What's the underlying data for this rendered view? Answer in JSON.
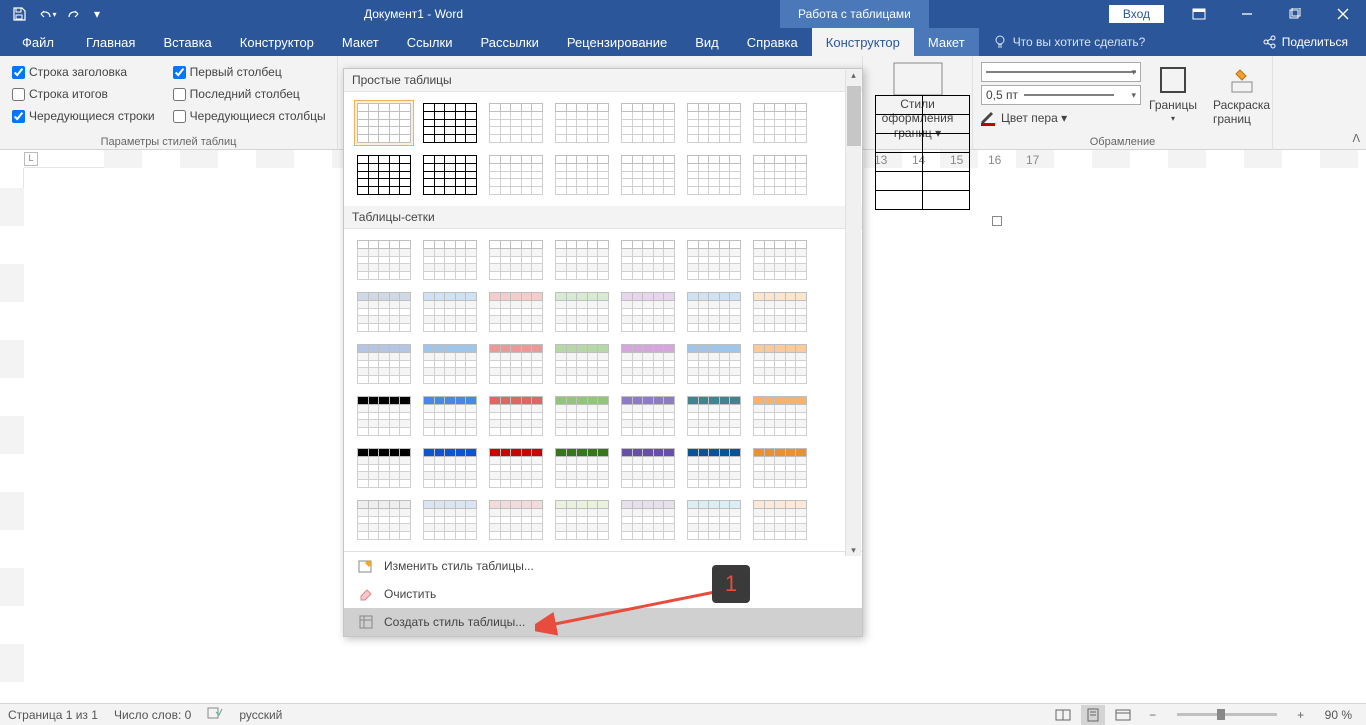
{
  "titlebar": {
    "doc_title": "Документ1 - Word",
    "context_tab": "Работа с таблицами",
    "login": "Вход"
  },
  "tabs": {
    "file": "Файл",
    "home": "Главная",
    "insert": "Вставка",
    "design": "Конструктор",
    "layout": "Макет",
    "refs": "Ссылки",
    "mailings": "Рассылки",
    "review": "Рецензирование",
    "view": "Вид",
    "help": "Справка",
    "ctx_design": "Конструктор",
    "ctx_layout": "Макет",
    "tell_me": "Что вы хотите сделать?",
    "share": "Поделиться"
  },
  "ribbon": {
    "style_options": {
      "header_row": "Строка заголовка",
      "total_row": "Строка итогов",
      "banded_rows": "Чередующиеся строки",
      "first_col": "Первый столбец",
      "last_col": "Последний столбец",
      "banded_cols": "Чередующиеся столбцы",
      "group_label": "Параметры стилей таблиц"
    },
    "shading_group": "Стили оформления границ ▾",
    "borders": {
      "line_weight": "0,5 пт",
      "pen_color": "Цвет пера ▾",
      "group_label": "Обрамление",
      "borders_btn": "Границы",
      "painter_btn": "Раскраска границ"
    }
  },
  "gallery": {
    "section_plain": "Простые таблицы",
    "section_grid": "Таблицы-сетки",
    "menu_modify": "Изменить стиль таблицы...",
    "menu_clear": "Очистить",
    "menu_new": "Создать стиль таблицы..."
  },
  "annotation": {
    "label": "1"
  },
  "statusbar": {
    "page": "Страница 1 из 1",
    "words": "Число слов: 0",
    "lang": "русский",
    "zoom": "90 %"
  },
  "ruler_marks": [
    "13",
    "14",
    "15",
    "16",
    "17"
  ]
}
